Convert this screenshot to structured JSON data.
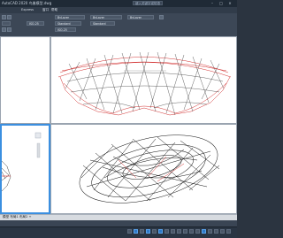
{
  "titlebar": {
    "title": "AutoCAD 2020   鸟巢模型.dwg",
    "search_placeholder": "键入关键字或短语"
  },
  "menu": [
    "Express",
    "窗口",
    "帮助"
  ],
  "ribbon": {
    "layer_combo_1": "ByLayer",
    "layer_combo_2": "ByLayer",
    "combo_iso": "ISO-25",
    "combo_standard_1": "Standard",
    "combo_standard_2": "Standard",
    "combo_bylayer": "ByLayer",
    "combo_iso_2": "ISO-25"
  },
  "layouts": "模型  布局1  布局2  +",
  "colors": {
    "active_border": "#3b8fe0",
    "wire_red": "#d23030",
    "wire_black": "#111111"
  }
}
